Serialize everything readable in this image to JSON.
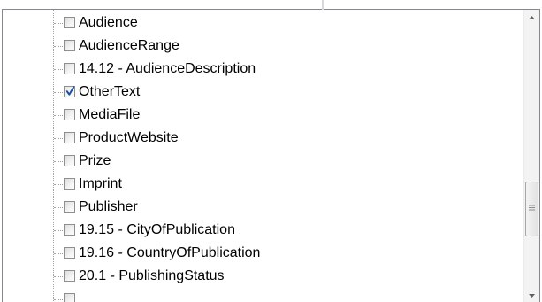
{
  "tree": {
    "items": [
      {
        "label": "Audience",
        "checked": false
      },
      {
        "label": "AudienceRange",
        "checked": false
      },
      {
        "label": "14.12 - AudienceDescription",
        "checked": false
      },
      {
        "label": "OtherText",
        "checked": true
      },
      {
        "label": "MediaFile",
        "checked": false
      },
      {
        "label": "ProductWebsite",
        "checked": false
      },
      {
        "label": "Prize",
        "checked": false
      },
      {
        "label": "Imprint",
        "checked": false
      },
      {
        "label": "Publisher",
        "checked": false
      },
      {
        "label": "19.15 - CityOfPublication",
        "checked": false
      },
      {
        "label": "19.16 - CountryOfPublication",
        "checked": false
      },
      {
        "label": "20.1 - PublishingStatus",
        "checked": false
      },
      {
        "label": "",
        "checked": false
      }
    ]
  },
  "scrollbar": {
    "up_icon": "arrow-up-icon",
    "down_icon": "arrow-down-icon",
    "position": 0.62
  },
  "colors": {
    "border": "#828790",
    "checkmark": "#1c4fa3",
    "connector": "#a0a0a0"
  }
}
